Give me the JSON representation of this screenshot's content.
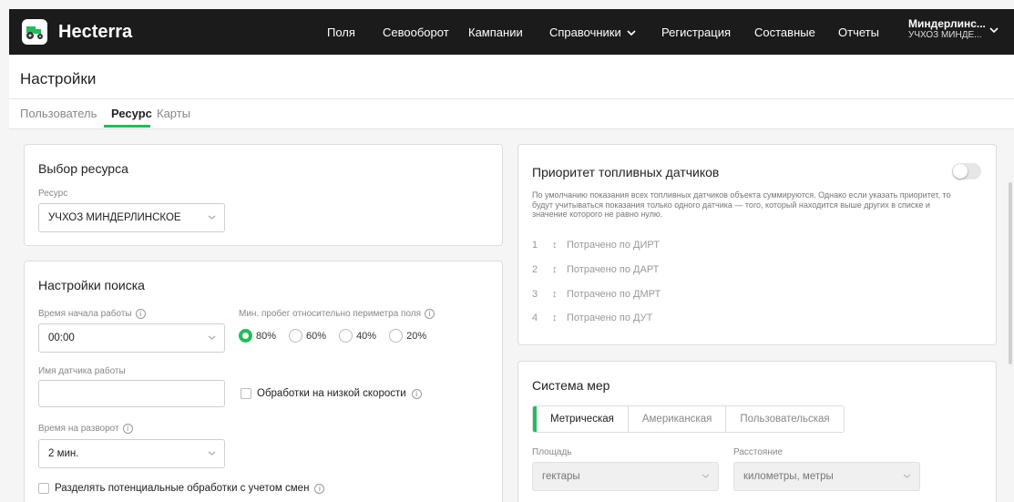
{
  "app": {
    "brand": "Hecterra"
  },
  "nav": {
    "items": [
      "Поля",
      "Севооборот",
      "Кампании",
      "Справочники",
      "Регистрация",
      "Составные",
      "Отчеты"
    ]
  },
  "user": {
    "name": "Миндерлинс...",
    "org": "УЧХОЗ МИНДЕ..."
  },
  "page": {
    "title": "Настройки"
  },
  "tabs": [
    "Пользователь",
    "Ресурс",
    "Карты"
  ],
  "resource_card": {
    "title": "Выбор ресурса",
    "resource_label": "Ресурс",
    "resource_value": "УЧХОЗ МИНДЕРЛИНСКОЕ"
  },
  "search_card": {
    "title": "Настройки поиска",
    "start_time_label": "Время начала работы",
    "start_time_value": "00:00",
    "min_run_label": "Мин. пробег относительно периметра поля",
    "min_run_options": [
      "80%",
      "60%",
      "40%",
      "20%"
    ],
    "min_run_selected": "80%",
    "sensor_label": "Имя датчика работы",
    "sensor_value": "",
    "low_speed_label": "Обработки на низкой скорости",
    "turn_label": "Время на разворот",
    "turn_value": "2 мин.",
    "split_label": "Разделять потенциальные обработки с учетом смен"
  },
  "fuel_card": {
    "title": "Приоритет топливных датчиков",
    "enabled": false,
    "description": "По умолчанию показания всех топливных датчиков объекта суммируются. Однако если указать приоритет, то будут учитываться показания только одного датчика — того, который находится выше других в списке и значение которого не равно нулю.",
    "items": [
      {
        "num": "1",
        "label": "Потрачено по ДИРТ"
      },
      {
        "num": "2",
        "label": "Потрачено по ДАРТ"
      },
      {
        "num": "3",
        "label": "Потрачено по ДМРТ"
      },
      {
        "num": "4",
        "label": "Потрачено по ДУТ"
      }
    ]
  },
  "units_card": {
    "title": "Система мер",
    "options": [
      "Метрическая",
      "Американская",
      "Пользовательская"
    ],
    "selected": "Метрическая",
    "area_label": "Площадь",
    "area_value": "гектары",
    "distance_label": "Расстояние",
    "distance_value": "километры, метры"
  },
  "colors": {
    "accent": "#1fbe5a",
    "topbar": "#1b1b1b"
  }
}
